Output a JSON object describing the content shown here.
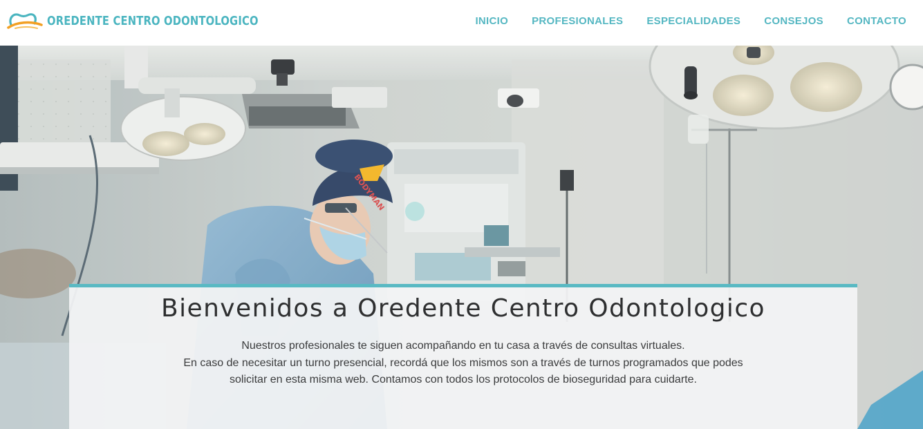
{
  "site": {
    "brand_name": "OREDENTE CENTRO ODONTOLOGICO",
    "logo_icon": "tooth-logo-icon",
    "colors": {
      "accent": "#4bb5c0",
      "logo_orange": "#f2a024",
      "logo_blue": "#4bb5c0",
      "panel_background": "#f2f3f4",
      "heading_text": "#2e2f30"
    }
  },
  "nav": {
    "items": [
      {
        "label": "INICIO"
      },
      {
        "label": "PROFESIONALES"
      },
      {
        "label": "ESPECIALIDADES"
      },
      {
        "label": "CONSEJOS"
      },
      {
        "label": "CONTACTO"
      }
    ]
  },
  "hero": {
    "background_image": "dental-surgeon-operating-room-photo",
    "cap_text": "BODYMAN"
  },
  "welcome": {
    "title": "Bienvenidos a Oredente Centro Odontologico",
    "lines": [
      "Nuestros profesionales te siguen acompañando en tu casa a través de consultas virtuales.",
      "En caso de necesitar un turno presencial, recordá que los mismos son a través de turnos programados que podes",
      "solicitar en esta misma web. Contamos con todos los protocolos de bioseguridad para cuidarte."
    ]
  }
}
